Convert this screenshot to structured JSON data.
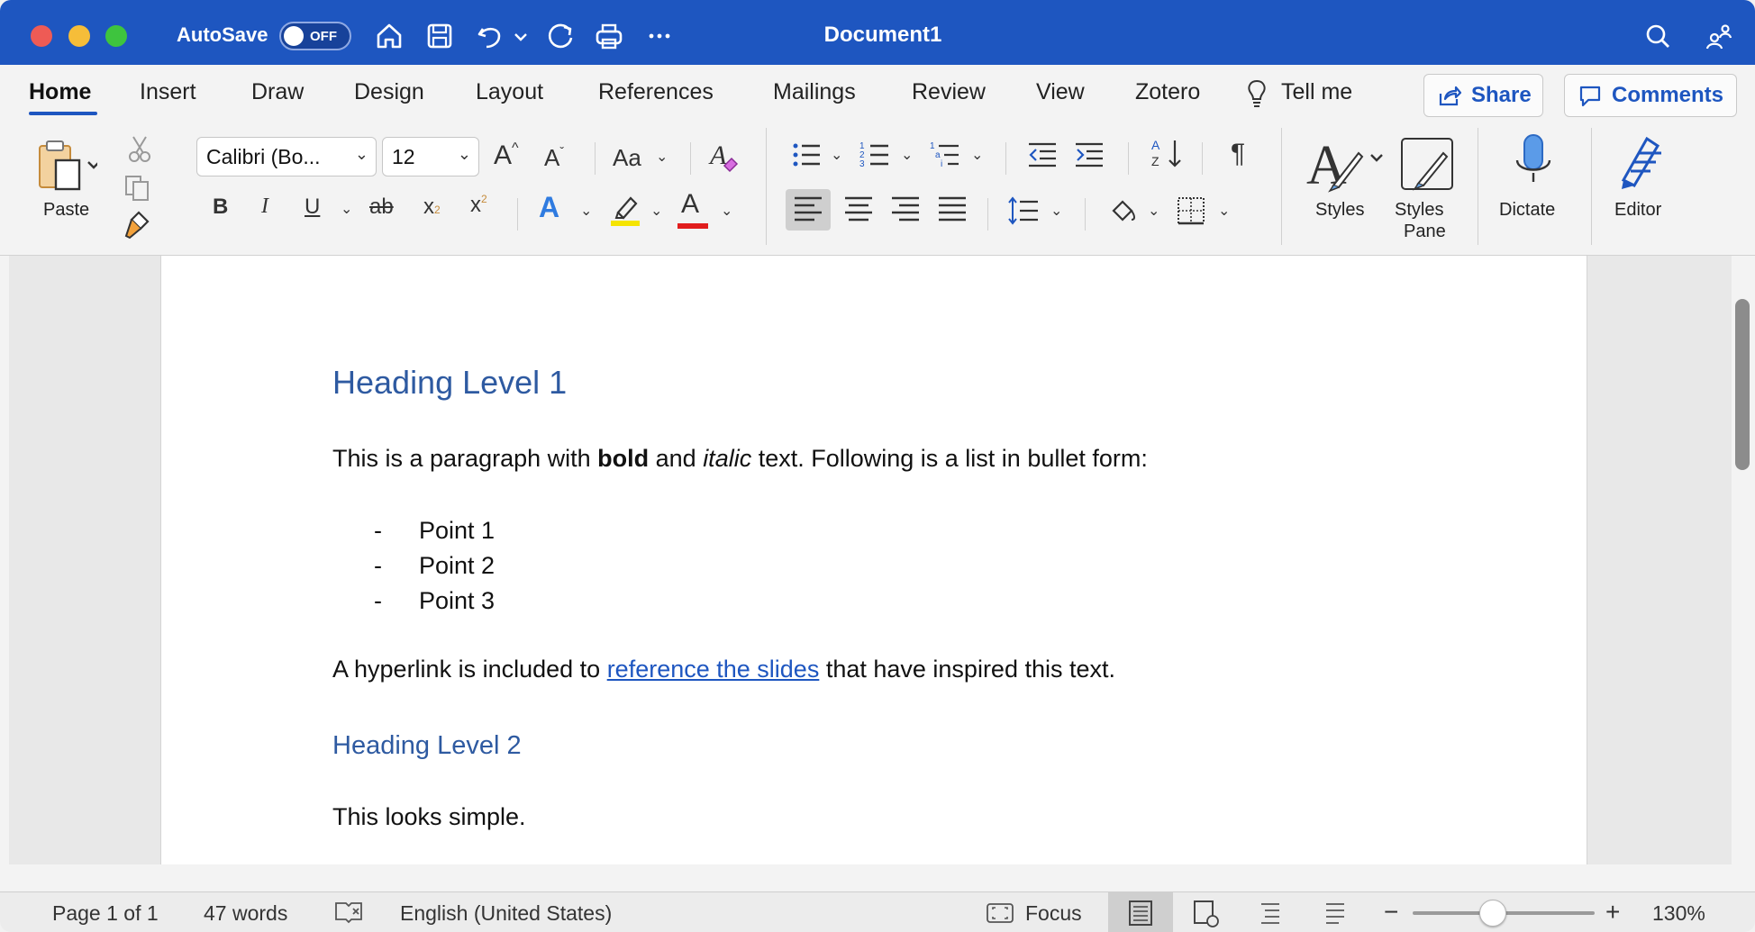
{
  "window": {
    "title": "Document1"
  },
  "quick_access": {
    "autosave_label": "AutoSave",
    "autosave_state": "OFF",
    "icons": [
      "home-icon",
      "save-icon",
      "undo-icon",
      "chevron-down-icon",
      "redo-icon",
      "print-icon",
      "more-icon"
    ]
  },
  "tabs": [
    {
      "label": "Home",
      "active": true
    },
    {
      "label": "Insert"
    },
    {
      "label": "Draw"
    },
    {
      "label": "Design"
    },
    {
      "label": "Layout"
    },
    {
      "label": "References"
    },
    {
      "label": "Mailings"
    },
    {
      "label": "Review"
    },
    {
      "label": "View"
    },
    {
      "label": "Zotero"
    },
    {
      "label": "Tell me"
    }
  ],
  "header_buttons": {
    "share": "Share",
    "comments": "Comments"
  },
  "ribbon": {
    "paste_label": "Paste",
    "font_name": "Calibri (Bo...",
    "font_size": "12",
    "change_case": "Aa",
    "bold": "B",
    "italic": "I",
    "underline": "U",
    "strike": "ab",
    "subscript": "x",
    "superscript": "x",
    "grow_font": "A",
    "shrink_font": "A",
    "text_effects": "A",
    "font_color": "A",
    "styles_label": "Styles",
    "styles_pane_label_1": "Styles",
    "styles_pane_label_2": "Pane",
    "dictate_label": "Dictate",
    "editor_label": "Editor",
    "highlight_color": "#f5e400",
    "font_color_bar": "#e11d1d"
  },
  "document": {
    "heading1": "Heading Level 1",
    "para1_a": "This is a paragraph with ",
    "para1_bold": "bold",
    "para1_b": " and ",
    "para1_italic": "italic",
    "para1_c": " text. Following is a list in bullet form:",
    "bullet_marker": "-",
    "bullets": [
      "Point 1",
      "Point 2",
      "Point 3"
    ],
    "para2_a": "A hyperlink is included to ",
    "para2_link": "reference the slides",
    "para2_b": " that have inspired this text.",
    "heading2": "Heading Level 2",
    "para3": "This looks simple."
  },
  "status": {
    "page": "Page 1 of 1",
    "words": "47 words",
    "language": "English (United States)",
    "focus": "Focus",
    "zoom": "130%",
    "zoom_fraction": 0.44
  },
  "colors": {
    "accent": "#1e56c0",
    "heading": "#2e5aa1"
  }
}
